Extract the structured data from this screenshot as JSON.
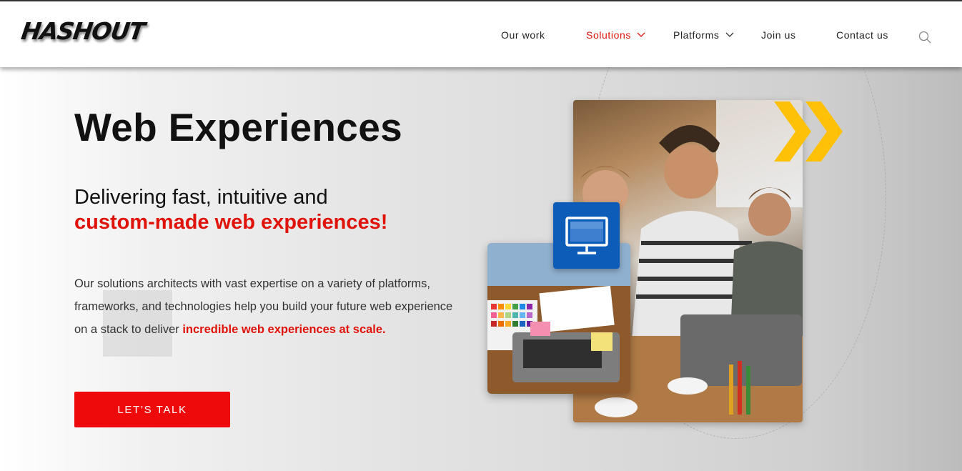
{
  "header": {
    "logo_text": "HASHOUT",
    "nav": [
      {
        "label": "Our work",
        "has_dropdown": false,
        "active": false
      },
      {
        "label": "Solutions",
        "has_dropdown": true,
        "active": true
      },
      {
        "label": "Platforms",
        "has_dropdown": true,
        "active": false
      },
      {
        "label": "Join us",
        "has_dropdown": false,
        "active": false
      },
      {
        "label": "Contact us",
        "has_dropdown": false,
        "active": false
      }
    ],
    "search_icon": "search-icon"
  },
  "hero": {
    "title": "Web Experiences",
    "subtitle_line1": "Delivering fast, intuitive and",
    "subtitle_line2": "custom-made web experiences!",
    "body_line1": "Our solutions architects with vast expertise on a variety of platforms,",
    "body_line2": "frameworks, and technologies help you build your future web experience",
    "body_line3_prefix": "on a stack to deliver ",
    "body_line3_highlight": "incredible web experiences at scale.",
    "cta_label": "LET’S TALK",
    "badge_icon": "monitor-icon",
    "accent_icon": "double-chevron-right-icon"
  },
  "colors": {
    "accent_red": "#e0130b",
    "cta_red": "#ee0a0a",
    "badge_blue": "#0d5cb8",
    "chevron_yellow": "#ffc107"
  }
}
